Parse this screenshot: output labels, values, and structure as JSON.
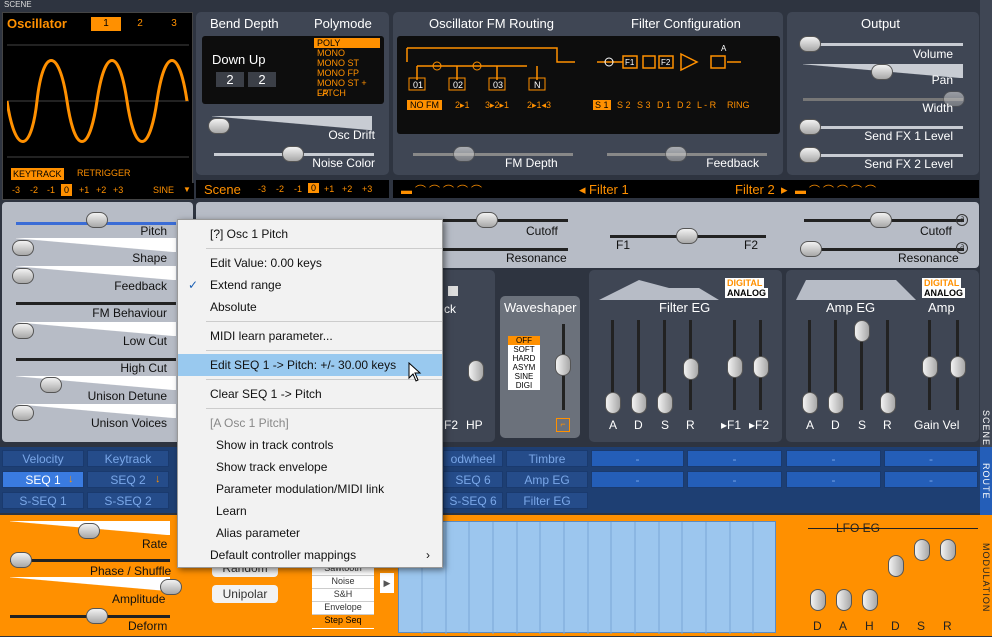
{
  "scene_label": "SCENE",
  "oscillator": {
    "title": "Oscillator",
    "tabs": [
      "1",
      "2",
      "3"
    ],
    "keytrack": "KEYTRACK",
    "retrigger": "RETRIGGER",
    "octaves": [
      "-3",
      "-2",
      "-1",
      "0",
      "+1",
      "+2",
      "+3"
    ],
    "wave": "SINE"
  },
  "bend": {
    "title": "Bend Depth",
    "down_up": "Down Up",
    "down": "2",
    "up": "2"
  },
  "polymode": {
    "title": "Polymode",
    "options": [
      "POLY",
      "MONO",
      "MONO ST",
      "MONO FP",
      "MONO ST + FP",
      "LATCH"
    ]
  },
  "osc_drift": "Osc Drift",
  "noise_color": "Noise Color",
  "scene_bar": {
    "label": "Scene",
    "octaves": [
      "-3",
      "-2",
      "-1",
      "0",
      "+1",
      "+2",
      "+3"
    ]
  },
  "fm": {
    "title": "Oscillator FM Routing",
    "nodes": [
      "01",
      "02",
      "03",
      "N"
    ],
    "modes": [
      "NO FM",
      "2▸1",
      "3▸2▸1",
      "2▸1◂3"
    ],
    "fm_depth": "FM Depth"
  },
  "filter_cfg": {
    "title": "Filter Configuration",
    "blocks": [
      "F1",
      "F2",
      "A"
    ],
    "modes": [
      "S 1",
      "S 2",
      "S 3",
      "D 1",
      "D 2",
      "L - R",
      "RING"
    ],
    "feedback": "Feedback"
  },
  "output": {
    "title": "Output",
    "sliders": [
      "Volume",
      "Pan",
      "Width",
      "Send FX 1 Level",
      "Send FX 2 Level"
    ]
  },
  "filter_bar": {
    "f1": "Filter 1",
    "f2": "Filter 2"
  },
  "filters": {
    "cutoff": "Cutoff",
    "resonance": "Resonance",
    "f1": "F1",
    "f2": "F2"
  },
  "osc_params": [
    "Pitch",
    "Shape",
    "Feedback",
    "FM Behaviour",
    "Low Cut",
    "High Cut",
    "Unison Detune",
    "Unison Voices"
  ],
  "mixer": {
    "hp": "HP",
    "f2": "F2",
    "k": "ck"
  },
  "waveshaper": {
    "title": "Waveshaper",
    "options": [
      "OFF",
      "SOFT",
      "HARD",
      "ASYM",
      "SINE",
      "DIGI"
    ]
  },
  "filter_eg": {
    "title": "Filter EG",
    "digital": "DIGITAL",
    "analog": "ANALOG",
    "sliders": [
      "A",
      "D",
      "S",
      "R",
      "▸F1",
      "▸F2"
    ]
  },
  "amp_eg": {
    "title": "Amp EG",
    "amp": "Amp",
    "digital": "DIGITAL",
    "analog": "ANALOG",
    "sliders": [
      "A",
      "D",
      "S",
      "R",
      "Gain Vel"
    ]
  },
  "routing": {
    "row1": [
      "Velocity",
      "Keytrack",
      "odwheel",
      "Timbre",
      "-",
      "-",
      "-",
      "-"
    ],
    "row2": [
      "SEQ 1",
      "SEQ 2",
      "SEQ 6",
      "Amp EG",
      "-",
      "-",
      "-",
      "-"
    ],
    "row3": [
      "S-SEQ 1",
      "S-SEQ 2",
      "S-SEQ 6",
      "Filter EG"
    ]
  },
  "lfo": {
    "rate": "Rate",
    "phase": "Phase / Shuffle",
    "amplitude": "Amplitude",
    "deform": "Deform",
    "random": "Random",
    "unipolar": "Unipolar",
    "types": [
      "Sawtooth",
      "Noise",
      "S&H",
      "Envelope",
      "Step Seq"
    ],
    "eg_title": "LFO EG",
    "eg": [
      "D",
      "A",
      "H",
      "D",
      "S",
      "R"
    ]
  },
  "side_labels": {
    "scene": "SCENE",
    "route": "ROUTE",
    "modulation": "MODULATION"
  },
  "context_menu": {
    "items": [
      {
        "label": "[?] Osc 1 Pitch"
      },
      {
        "label": "Edit Value: 0.00 keys"
      },
      {
        "label": "Extend range",
        "checked": true
      },
      {
        "label": "Absolute"
      },
      {
        "label": "MIDI learn parameter..."
      },
      {
        "label": "Edit SEQ 1 -> Pitch: +/- 30.00 keys",
        "highlighted": true
      },
      {
        "label": "Clear SEQ 1 -> Pitch"
      },
      {
        "label": "[A Osc 1 Pitch]",
        "disabled": true
      },
      {
        "label": "Show in track controls"
      },
      {
        "label": "Show track envelope"
      },
      {
        "label": "Parameter modulation/MIDI link"
      },
      {
        "label": "Learn"
      },
      {
        "label": "Alias parameter"
      },
      {
        "label": "Default controller mappings"
      }
    ],
    "checkmark": "✓",
    "submenu_arrow": "›"
  }
}
